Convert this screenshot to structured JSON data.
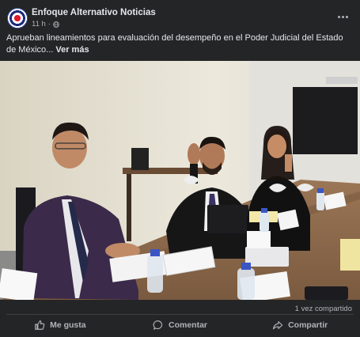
{
  "post": {
    "page_name": "Enfoque Alternativo Noticias",
    "time": "11 h",
    "separator": "·",
    "caption": "Aprueban lineamientos para evaluación del desempeño en el Poder Judicial del Estado de México...",
    "see_more": "Ver más",
    "photo_alt": "Funcionarios sentados en una mesa de reuniones",
    "shared_count": "1 vez compartido"
  },
  "actions": {
    "like": "Me gusta",
    "comment": "Comentar",
    "share": "Compartir"
  },
  "icons": {
    "avatar": "page-logo-icon",
    "privacy": "globe-icon",
    "more": "more-options-icon",
    "like": "thumbs-up-icon",
    "comment": "comment-bubble-icon",
    "share": "share-arrow-icon"
  },
  "colors": {
    "background": "#242526",
    "text_primary": "#e4e6eb",
    "text_secondary": "#b0b3b8"
  }
}
